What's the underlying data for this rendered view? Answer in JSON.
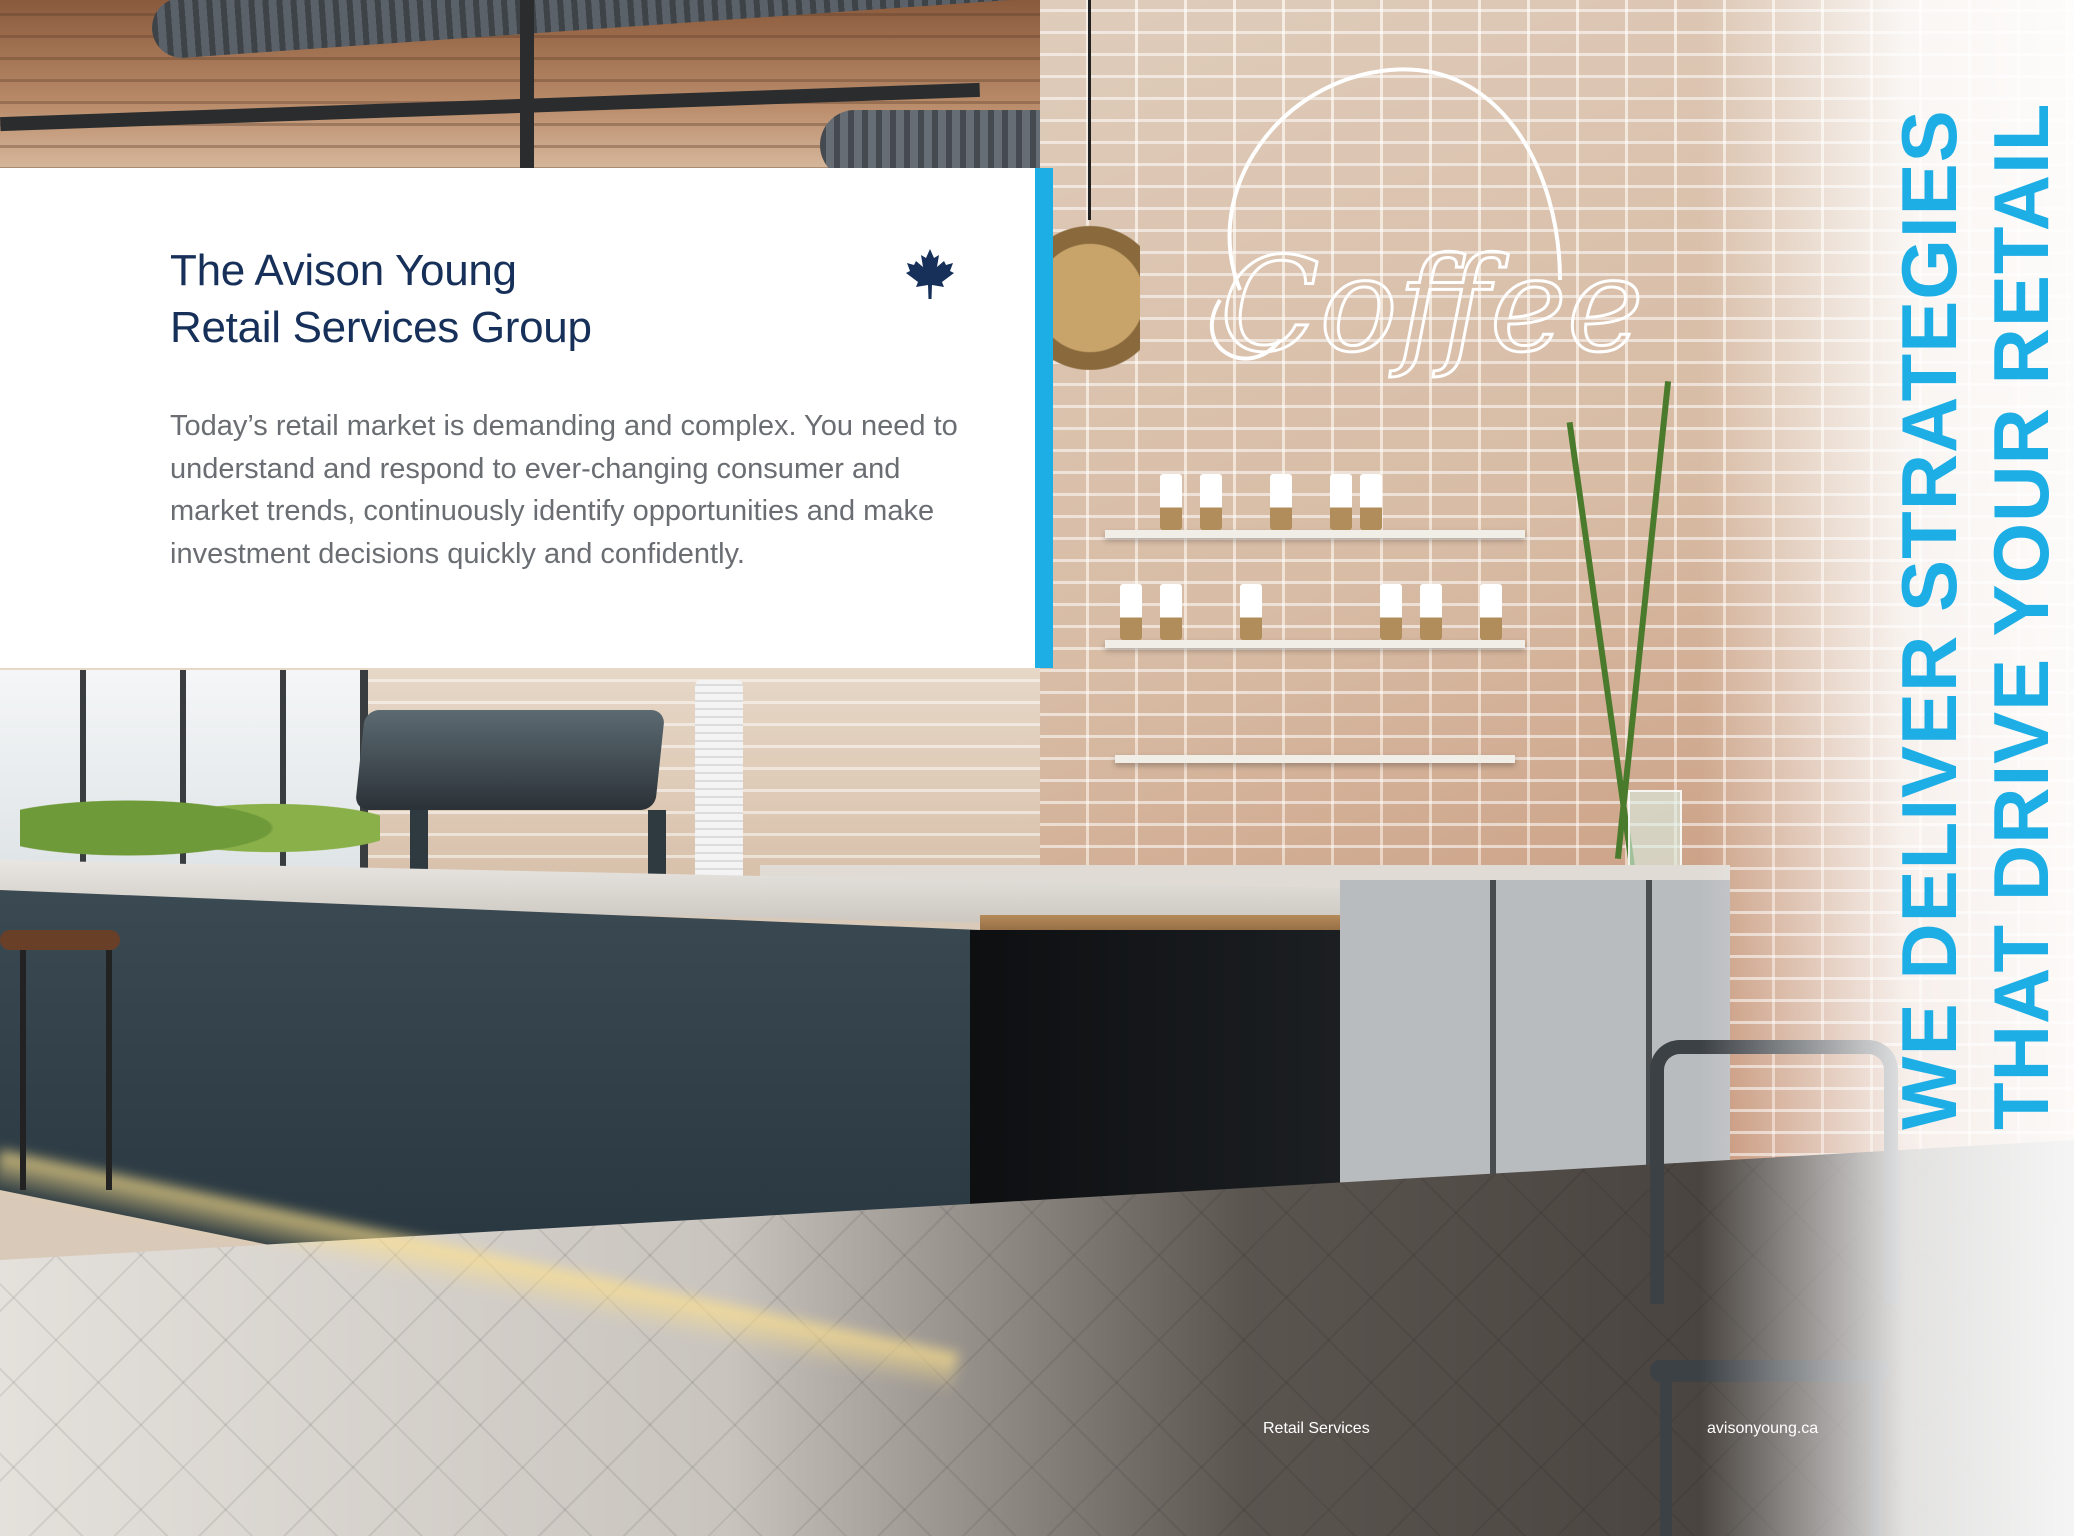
{
  "panel": {
    "title_line1": "The Avison Young",
    "title_line2": "Retail Services Group",
    "body": "Today’s retail market is demanding and complex. You need to understand and respond to ever-changing consumer and market trends, continuously identify opportunities and make investment decisions quickly and confidently.",
    "icon": "maple-leaf-icon"
  },
  "neon_sign": {
    "text": "Coffee"
  },
  "tagline": {
    "line1": "WE DELIVER STRATEGIES",
    "line2": "THAT DRIVE YOUR RETAIL"
  },
  "footer": {
    "section": "Retail Services",
    "website": "avisonyoung.ca"
  },
  "colors": {
    "accent": "#1eaee6",
    "navy": "#17305a",
    "body_text": "#6a6d72"
  }
}
